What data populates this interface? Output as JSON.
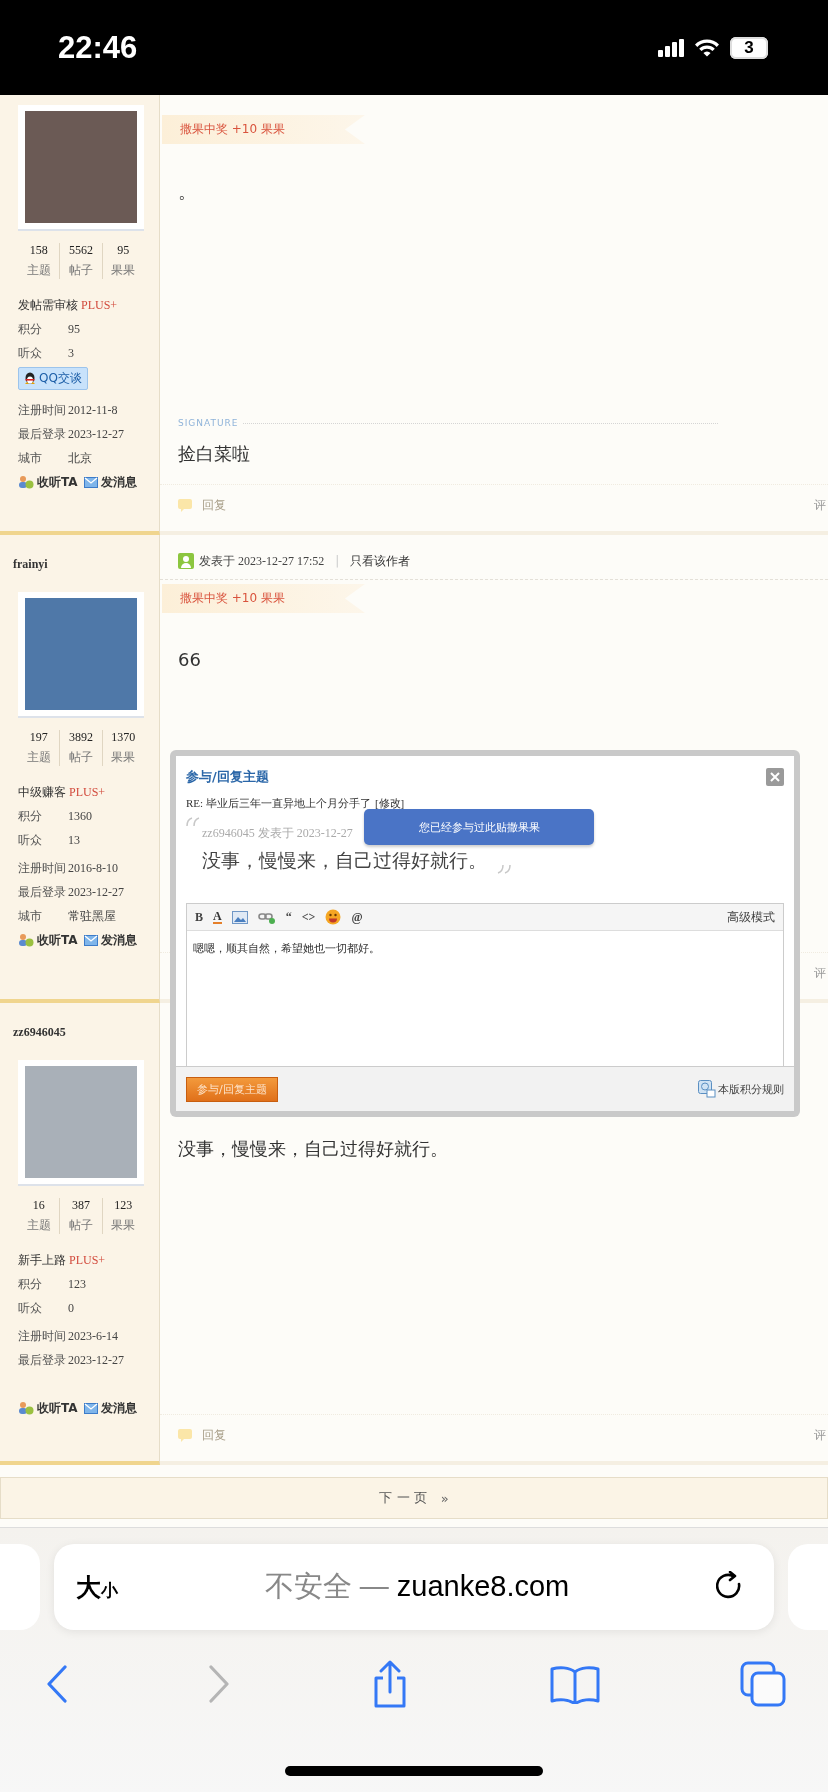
{
  "status_bar": {
    "time": "22:46",
    "battery": "3"
  },
  "posts": [
    {
      "stats": [
        {
          "value": "158",
          "label": "主题"
        },
        {
          "value": "5562",
          "label": "帖子"
        },
        {
          "value": "95",
          "label": "果果"
        }
      ],
      "rank": "发帖需审核",
      "plus": "PLUS+",
      "fields": [
        {
          "label": "积分",
          "value": "95"
        },
        {
          "label": "听众",
          "value": "3"
        }
      ],
      "qq_button": "QQ交谈",
      "profile": [
        {
          "label": "注册时间",
          "value": "2012-11-8"
        },
        {
          "label": "最后登录",
          "value": "2023-12-27"
        },
        {
          "label": "城市",
          "value": "北京"
        }
      ],
      "follow": "收听TA",
      "message": "发消息",
      "award": "撒果中奖 +10 果果",
      "body": "。",
      "signature_label": "SIGNATURE",
      "signature": "捡白菜啦",
      "reply": "回复",
      "rate": "评"
    },
    {
      "author": "frainyi",
      "header": {
        "posted": "发表于 2023-12-27 17:52",
        "separator": "|",
        "view_author": "只看该作者"
      },
      "stats": [
        {
          "value": "197",
          "label": "主题"
        },
        {
          "value": "3892",
          "label": "帖子"
        },
        {
          "value": "1370",
          "label": "果果"
        }
      ],
      "rank": "中级赚客",
      "plus": "PLUS+",
      "fields": [
        {
          "label": "积分",
          "value": "1360"
        },
        {
          "label": "听众",
          "value": "13"
        }
      ],
      "profile": [
        {
          "label": "注册时间",
          "value": "2016-8-10"
        },
        {
          "label": "最后登录",
          "value": "2023-12-27"
        },
        {
          "label": "城市",
          "value": "常驻黑屋"
        }
      ],
      "follow": "收听TA",
      "message": "发消息",
      "award": "撒果中奖 +10 果果",
      "body": "66",
      "rate": "评"
    },
    {
      "author": "zz6946045",
      "stats": [
        {
          "value": "16",
          "label": "主题"
        },
        {
          "value": "387",
          "label": "帖子"
        },
        {
          "value": "123",
          "label": "果果"
        }
      ],
      "rank": "新手上路",
      "plus": "PLUS+",
      "fields": [
        {
          "label": "积分",
          "value": "123"
        },
        {
          "label": "听众",
          "value": "0"
        }
      ],
      "profile": [
        {
          "label": "注册时间",
          "value": "2023-6-14"
        },
        {
          "label": "最后登录",
          "value": "2023-12-27"
        }
      ],
      "follow": "收听TA",
      "message": "发消息",
      "body": "没事，慢慢来，自己过得好就行。",
      "reply": "回复",
      "rate": "评"
    }
  ],
  "pager": {
    "next": "下 一 页",
    "arrow": "»"
  },
  "dialog": {
    "title": "参与/回复主题",
    "subject": "RE: 毕业后三年一直异地上个月分手了",
    "edit_link": "[修改]",
    "quote_meta": "zz6946045 发表于 2023-12-27",
    "quote_text": "没事，慢慢来，自己过得好就行。",
    "toast": "您已经参与过此贴撒果果",
    "tools": [
      {
        "kind": "text",
        "label": "B"
      },
      {
        "kind": "font-color",
        "label": "A"
      },
      {
        "kind": "image"
      },
      {
        "kind": "link"
      },
      {
        "kind": "text",
        "label": "“"
      },
      {
        "kind": "text",
        "label": "<>"
      },
      {
        "kind": "emoji"
      },
      {
        "kind": "text",
        "label": "@"
      }
    ],
    "advanced_mode": "高级模式",
    "reply_value": "嗯嗯，顺其自然，希望她也一切都好。",
    "submit": "参与/回复主题",
    "rules": "本版积分规则"
  },
  "browser": {
    "text_size": {
      "large": "大",
      "small": "小"
    },
    "security": "不安全",
    "separator": "—",
    "domain": "zuanke8.com",
    "back_disabled": false,
    "forward_disabled": true
  }
}
